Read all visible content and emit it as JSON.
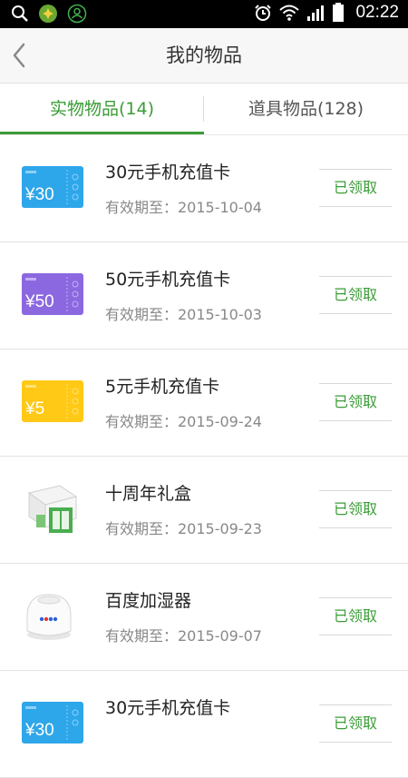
{
  "status_bar": {
    "time": "02:22"
  },
  "header": {
    "title": "我的物品"
  },
  "tabs": [
    {
      "label": "实物物品(14)"
    },
    {
      "label": "道具物品(128)"
    }
  ],
  "items": [
    {
      "name": "30元手机充值卡",
      "expiry": "有效期至：2015-10-04",
      "action": "已领取",
      "card_amount": "¥30",
      "card_color": "#2ea6ea",
      "icon": "recharge-card-icon"
    },
    {
      "name": "50元手机充值卡",
      "expiry": "有效期至：2015-10-03",
      "action": "已领取",
      "card_amount": "¥50",
      "card_color": "#8b68e0",
      "icon": "recharge-card-icon"
    },
    {
      "name": "5元手机充值卡",
      "expiry": "有效期至：2015-09-24",
      "action": "已领取",
      "card_amount": "¥5",
      "card_color": "#ffc916",
      "icon": "recharge-card-icon"
    },
    {
      "name": "十周年礼盒",
      "expiry": "有效期至：2015-09-23",
      "action": "已领取",
      "icon": "gift-box-icon"
    },
    {
      "name": "百度加湿器",
      "expiry": "有效期至：2015-09-07",
      "action": "已领取",
      "icon": "humidifier-icon"
    },
    {
      "name": "30元手机充值卡",
      "expiry": "",
      "action": "已领取",
      "card_amount": "¥30",
      "card_color": "#2ea6ea",
      "icon": "recharge-card-icon"
    }
  ],
  "colors": {
    "accent": "#3a9c36",
    "header_bg": "#f7f7f7"
  }
}
